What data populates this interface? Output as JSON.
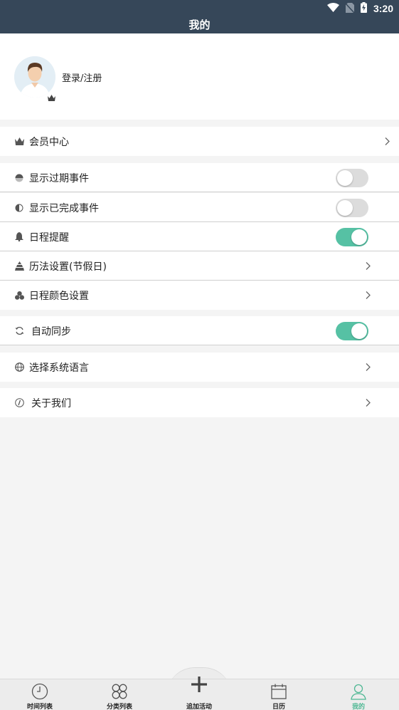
{
  "status": {
    "time": "3:20"
  },
  "header": {
    "title": "我的"
  },
  "profile": {
    "login_label": "登录/注册"
  },
  "menu": {
    "vip": {
      "label": "会员中心",
      "icon": "crown-icon"
    },
    "show_expired": {
      "label": "显示过期事件",
      "icon": "half-circle-icon",
      "enabled": false
    },
    "show_completed": {
      "label": "显示已完成事件",
      "icon": "contrast-icon",
      "enabled": false
    },
    "reminder": {
      "label": "日程提醒",
      "icon": "bell-icon",
      "enabled": true
    },
    "calendar_settings": {
      "label": "历法设置(节假日)",
      "icon": "pagoda-icon"
    },
    "color_settings": {
      "label": "日程颜色设置",
      "icon": "palette-icon"
    },
    "auto_sync": {
      "label": "自动同步",
      "icon": "sync-icon",
      "enabled": true
    },
    "language": {
      "label": "选择系统语言",
      "icon": "globe-icon"
    },
    "about": {
      "label": "关于我们",
      "icon": "info-icon"
    }
  },
  "tabs": [
    {
      "label": "时间列表",
      "icon": "clock-icon"
    },
    {
      "label": "分类列表",
      "icon": "category-icon"
    },
    {
      "label": "追加活动",
      "icon": "plus-icon"
    },
    {
      "label": "日历",
      "icon": "calendar-icon"
    },
    {
      "label": "我的",
      "icon": "person-icon",
      "active": true
    }
  ],
  "colors": {
    "header_bg": "#364759",
    "accent": "#56c1a4",
    "tab_active": "#4fb894"
  }
}
